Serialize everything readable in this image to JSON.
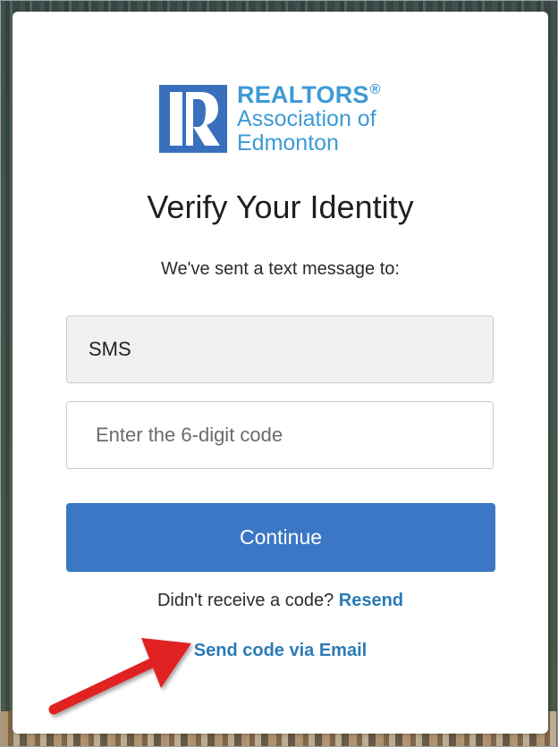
{
  "logo": {
    "line1": "REALTORS",
    "registered": "®",
    "line2": "Association of",
    "line3": "Edmonton",
    "brand_color": "#3d9ad6",
    "mark_color": "#3a6fbd"
  },
  "page": {
    "title": "Verify Your Identity",
    "subtitle": "We've sent a text message to:"
  },
  "sms_field": {
    "value": "SMS"
  },
  "code_field": {
    "placeholder": "Enter the 6-digit code",
    "value": ""
  },
  "continue_button": {
    "label": "Continue",
    "color": "#3b77c4"
  },
  "resend": {
    "prompt": "Didn't receive a code?",
    "link_label": "Resend"
  },
  "email_link": {
    "label": "Send code via Email"
  },
  "annotation": {
    "arrow_color": "#e02020",
    "icon": "red-arrow-icon"
  }
}
